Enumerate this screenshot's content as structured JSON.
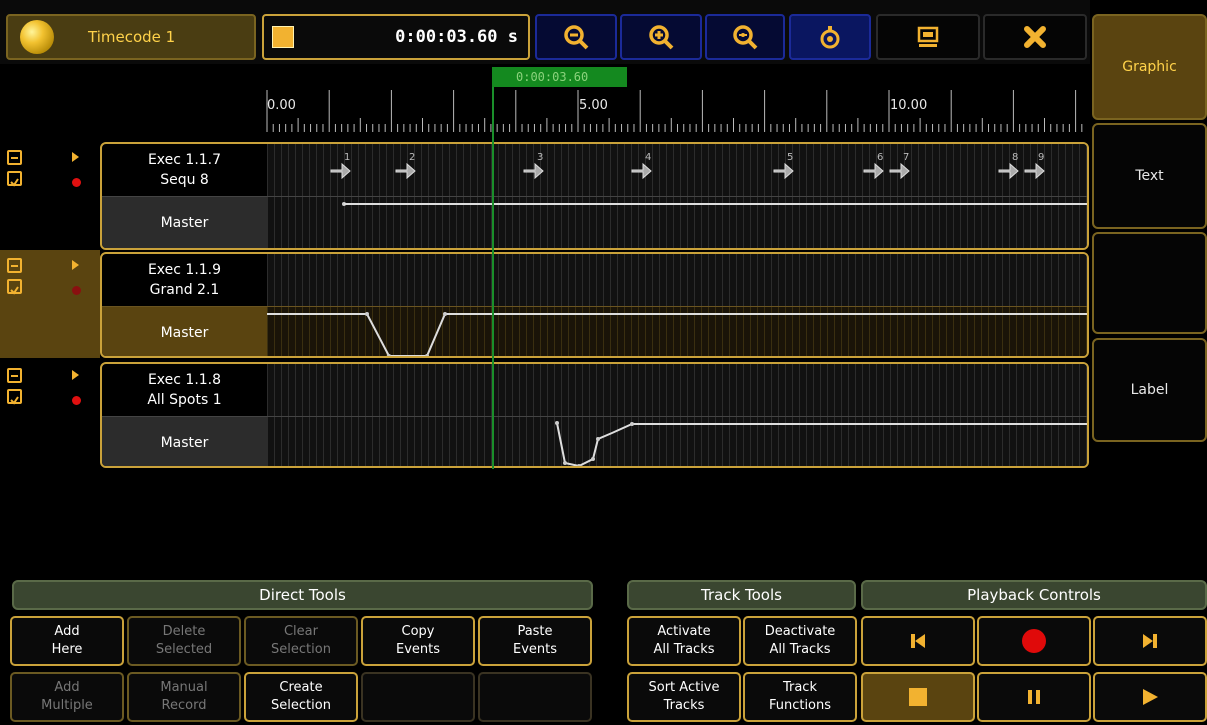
{
  "window": {
    "title": "Timecode 1",
    "time": "0:00:03.60 s"
  },
  "toolbar": {
    "icons": [
      "zoom-out-icon",
      "zoom-in-icon",
      "zoom-fit-icon",
      "stopwatch-icon",
      "screen-icon",
      "close-icon"
    ]
  },
  "right_panel": {
    "items": [
      "Graphic",
      "Text",
      "",
      "Label"
    ],
    "active": "Graphic"
  },
  "ruler": {
    "labels": [
      "0.00",
      "5.00",
      "10.00"
    ],
    "playhead": "0:00:03.60"
  },
  "tracks": [
    {
      "exec": "Exec 1.1.7",
      "name": "Sequ 8",
      "lane": "Master",
      "cues": [
        "1",
        "2",
        "3",
        "4",
        "5",
        "6",
        "7",
        "8",
        "9"
      ]
    },
    {
      "exec": "Exec 1.1.9",
      "name": "Grand 2.1",
      "lane": "Master"
    },
    {
      "exec": "Exec 1.1.8",
      "name": "All Spots 1",
      "lane": "Master"
    }
  ],
  "direct_tools": {
    "header": "Direct Tools",
    "row1": [
      "Add\nHere",
      "Delete\nSelected",
      "Clear\nSelection",
      "Copy\nEvents",
      "Paste\nEvents"
    ],
    "row2": [
      "Add\nMultiple",
      "Manual\nRecord",
      "Create\nSelection",
      "",
      ""
    ]
  },
  "track_tools": {
    "header": "Track Tools",
    "row1": [
      "Activate\nAll Tracks",
      "Deactivate\nAll Tracks"
    ],
    "row2": [
      "Sort Active\nTracks",
      "Track\nFunctions"
    ]
  },
  "playback": {
    "header": "Playback Controls",
    "icons": [
      "skip-back-icon",
      "record-icon",
      "skip-forward-icon",
      "stop-icon",
      "pause-icon",
      "play-icon"
    ]
  },
  "colors": {
    "accent": "#caa23a",
    "playhead": "#1a8f2a",
    "toolbar_blue": "#1b2a99"
  }
}
